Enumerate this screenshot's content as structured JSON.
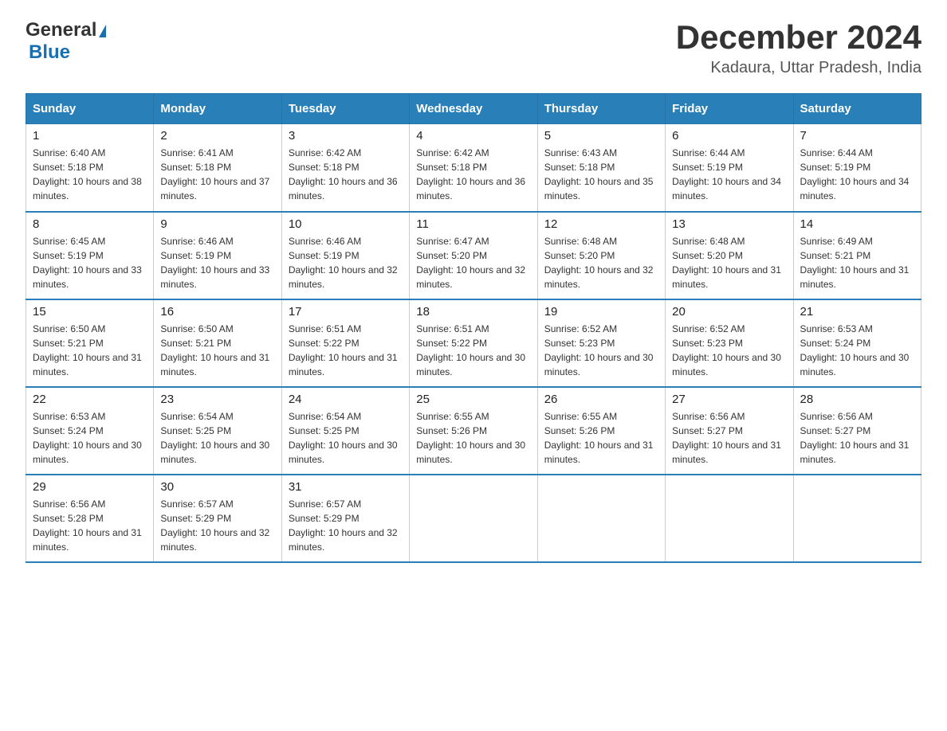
{
  "header": {
    "logo_general": "General",
    "logo_blue": "Blue",
    "month_title": "December 2024",
    "location": "Kadaura, Uttar Pradesh, India"
  },
  "days_of_week": [
    "Sunday",
    "Monday",
    "Tuesday",
    "Wednesday",
    "Thursday",
    "Friday",
    "Saturday"
  ],
  "weeks": [
    [
      {
        "day": "1",
        "sunrise": "6:40 AM",
        "sunset": "5:18 PM",
        "daylight": "10 hours and 38 minutes."
      },
      {
        "day": "2",
        "sunrise": "6:41 AM",
        "sunset": "5:18 PM",
        "daylight": "10 hours and 37 minutes."
      },
      {
        "day": "3",
        "sunrise": "6:42 AM",
        "sunset": "5:18 PM",
        "daylight": "10 hours and 36 minutes."
      },
      {
        "day": "4",
        "sunrise": "6:42 AM",
        "sunset": "5:18 PM",
        "daylight": "10 hours and 36 minutes."
      },
      {
        "day": "5",
        "sunrise": "6:43 AM",
        "sunset": "5:18 PM",
        "daylight": "10 hours and 35 minutes."
      },
      {
        "day": "6",
        "sunrise": "6:44 AM",
        "sunset": "5:19 PM",
        "daylight": "10 hours and 34 minutes."
      },
      {
        "day": "7",
        "sunrise": "6:44 AM",
        "sunset": "5:19 PM",
        "daylight": "10 hours and 34 minutes."
      }
    ],
    [
      {
        "day": "8",
        "sunrise": "6:45 AM",
        "sunset": "5:19 PM",
        "daylight": "10 hours and 33 minutes."
      },
      {
        "day": "9",
        "sunrise": "6:46 AM",
        "sunset": "5:19 PM",
        "daylight": "10 hours and 33 minutes."
      },
      {
        "day": "10",
        "sunrise": "6:46 AM",
        "sunset": "5:19 PM",
        "daylight": "10 hours and 32 minutes."
      },
      {
        "day": "11",
        "sunrise": "6:47 AM",
        "sunset": "5:20 PM",
        "daylight": "10 hours and 32 minutes."
      },
      {
        "day": "12",
        "sunrise": "6:48 AM",
        "sunset": "5:20 PM",
        "daylight": "10 hours and 32 minutes."
      },
      {
        "day": "13",
        "sunrise": "6:48 AM",
        "sunset": "5:20 PM",
        "daylight": "10 hours and 31 minutes."
      },
      {
        "day": "14",
        "sunrise": "6:49 AM",
        "sunset": "5:21 PM",
        "daylight": "10 hours and 31 minutes."
      }
    ],
    [
      {
        "day": "15",
        "sunrise": "6:50 AM",
        "sunset": "5:21 PM",
        "daylight": "10 hours and 31 minutes."
      },
      {
        "day": "16",
        "sunrise": "6:50 AM",
        "sunset": "5:21 PM",
        "daylight": "10 hours and 31 minutes."
      },
      {
        "day": "17",
        "sunrise": "6:51 AM",
        "sunset": "5:22 PM",
        "daylight": "10 hours and 31 minutes."
      },
      {
        "day": "18",
        "sunrise": "6:51 AM",
        "sunset": "5:22 PM",
        "daylight": "10 hours and 30 minutes."
      },
      {
        "day": "19",
        "sunrise": "6:52 AM",
        "sunset": "5:23 PM",
        "daylight": "10 hours and 30 minutes."
      },
      {
        "day": "20",
        "sunrise": "6:52 AM",
        "sunset": "5:23 PM",
        "daylight": "10 hours and 30 minutes."
      },
      {
        "day": "21",
        "sunrise": "6:53 AM",
        "sunset": "5:24 PM",
        "daylight": "10 hours and 30 minutes."
      }
    ],
    [
      {
        "day": "22",
        "sunrise": "6:53 AM",
        "sunset": "5:24 PM",
        "daylight": "10 hours and 30 minutes."
      },
      {
        "day": "23",
        "sunrise": "6:54 AM",
        "sunset": "5:25 PM",
        "daylight": "10 hours and 30 minutes."
      },
      {
        "day": "24",
        "sunrise": "6:54 AM",
        "sunset": "5:25 PM",
        "daylight": "10 hours and 30 minutes."
      },
      {
        "day": "25",
        "sunrise": "6:55 AM",
        "sunset": "5:26 PM",
        "daylight": "10 hours and 30 minutes."
      },
      {
        "day": "26",
        "sunrise": "6:55 AM",
        "sunset": "5:26 PM",
        "daylight": "10 hours and 31 minutes."
      },
      {
        "day": "27",
        "sunrise": "6:56 AM",
        "sunset": "5:27 PM",
        "daylight": "10 hours and 31 minutes."
      },
      {
        "day": "28",
        "sunrise": "6:56 AM",
        "sunset": "5:27 PM",
        "daylight": "10 hours and 31 minutes."
      }
    ],
    [
      {
        "day": "29",
        "sunrise": "6:56 AM",
        "sunset": "5:28 PM",
        "daylight": "10 hours and 31 minutes."
      },
      {
        "day": "30",
        "sunrise": "6:57 AM",
        "sunset": "5:29 PM",
        "daylight": "10 hours and 32 minutes."
      },
      {
        "day": "31",
        "sunrise": "6:57 AM",
        "sunset": "5:29 PM",
        "daylight": "10 hours and 32 minutes."
      },
      null,
      null,
      null,
      null
    ]
  ]
}
